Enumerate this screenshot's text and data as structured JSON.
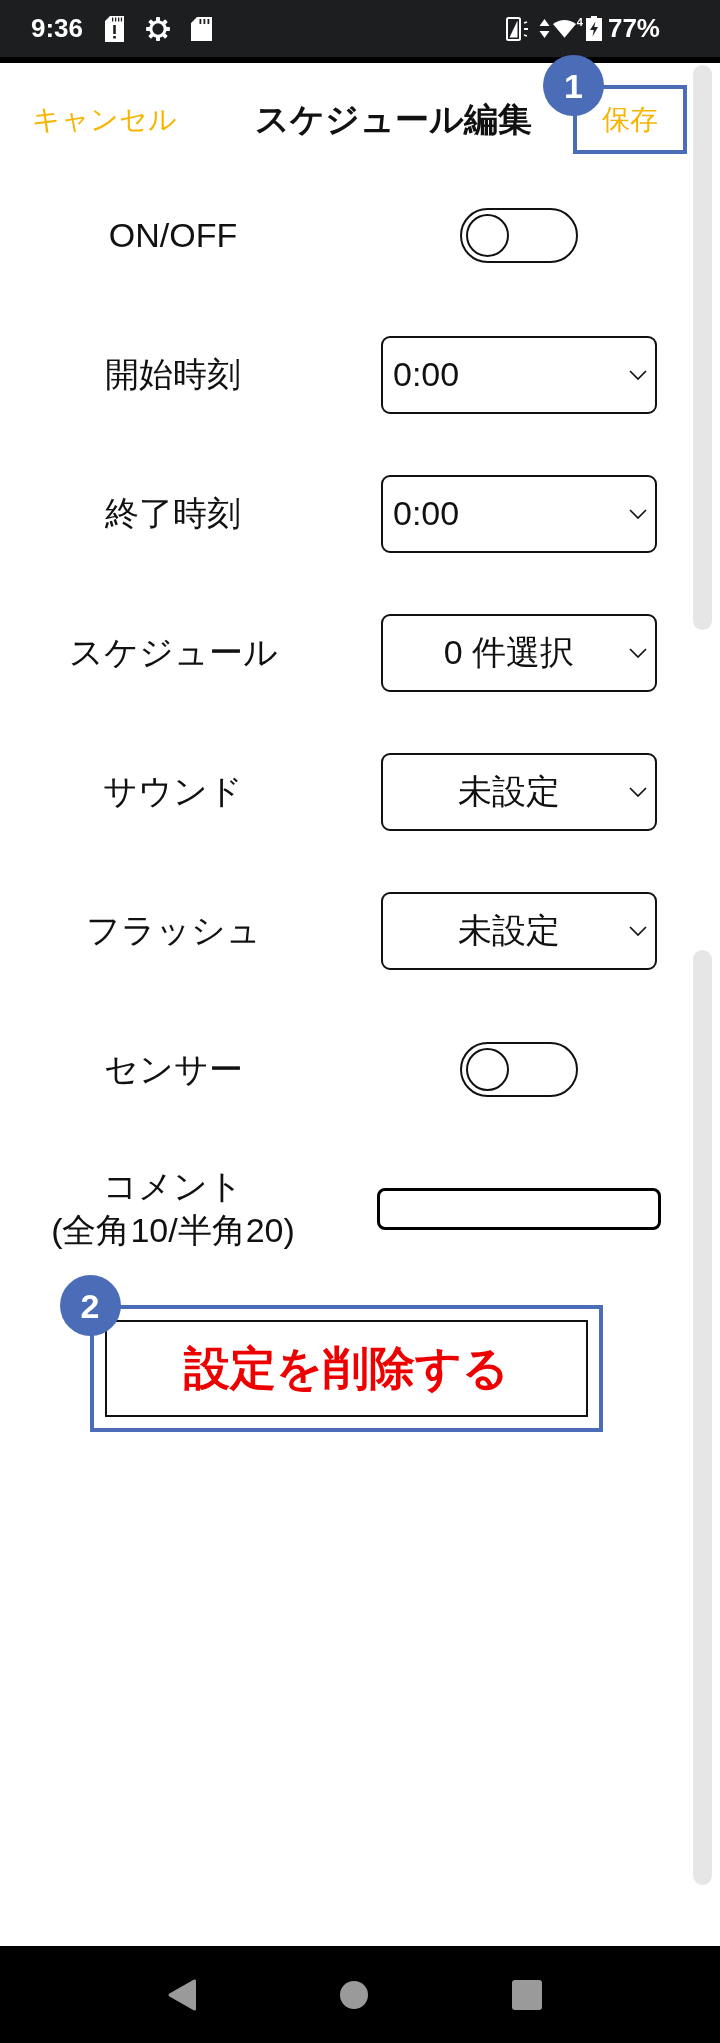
{
  "status_bar": {
    "time": "9:36",
    "network": "4",
    "battery": "77%"
  },
  "header": {
    "cancel": "キャンセル",
    "title": "スケジュール編集",
    "save": {
      "label": "保存",
      "callout": "1"
    }
  },
  "settings": [
    {
      "kind": "toggle",
      "label": "ON/OFF",
      "on": false
    },
    {
      "kind": "time",
      "label": "開始時刻",
      "value": "0:00"
    },
    {
      "kind": "time",
      "label": "終了時刻",
      "value": "0:00"
    },
    {
      "kind": "select",
      "label": "スケジュール",
      "value": "0 件選択"
    },
    {
      "kind": "select",
      "label": "サウンド",
      "value": "未設定"
    },
    {
      "kind": "select",
      "label": "フラッシュ",
      "value": "未設定"
    },
    {
      "kind": "toggle",
      "label": "センサー",
      "on": false
    },
    {
      "kind": "text",
      "label": "コメント",
      "note": "(全角10/半角20)"
    }
  ],
  "delete_button": {
    "label": "設定を削除する",
    "callout": "2"
  }
}
